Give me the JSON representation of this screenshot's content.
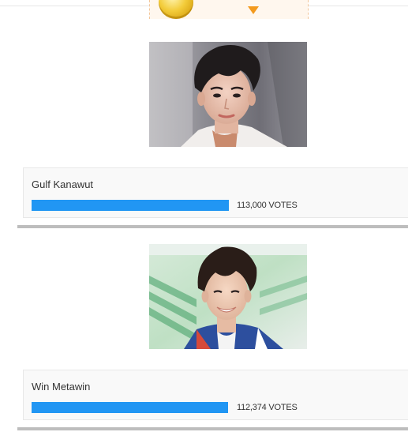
{
  "candidates": [
    {
      "name": "Gulf Kanawut",
      "votes_text": "113,000 VOTES",
      "bar_fraction": 1.0
    },
    {
      "name": "Win Metawin",
      "votes_text": "112,374 VOTES",
      "bar_fraction": 0.995
    }
  ],
  "colors": {
    "accent_bar": "#2196f3",
    "separator": "#bdbdbd",
    "card_background": "#f9f9f9"
  },
  "icons": [
    "gold-coin-icon",
    "arrow-down-icon"
  ]
}
